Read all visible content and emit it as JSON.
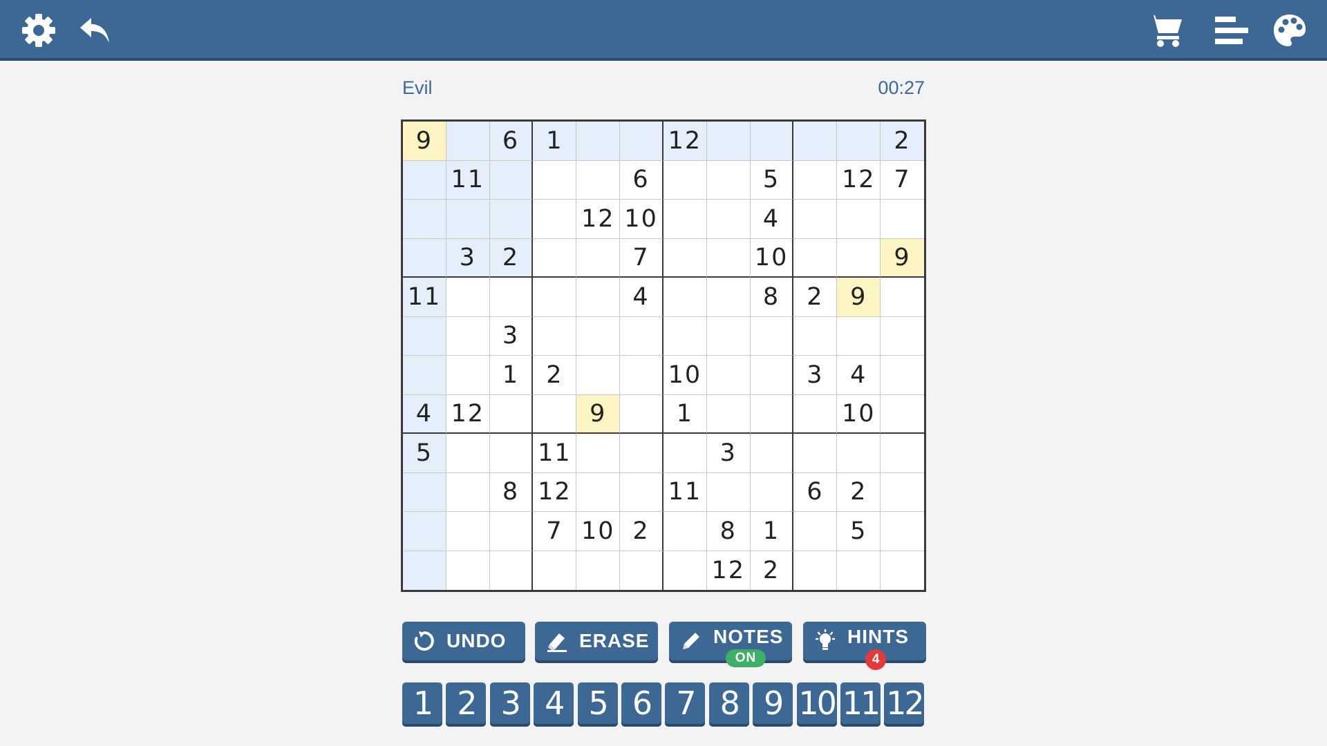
{
  "toolbar": {
    "left_icons": [
      "gear-icon",
      "back-arrow-icon"
    ],
    "right_icons": [
      "cart-icon",
      "menu-icon",
      "palette-icon"
    ]
  },
  "game": {
    "difficulty": "Evil",
    "timer": "00:27"
  },
  "board": {
    "size": 12,
    "box_rows": 4,
    "box_cols": 3,
    "selected_cell": [
      0,
      0
    ],
    "selected_value": "9",
    "cells": [
      [
        "9",
        "",
        "6",
        "1",
        "",
        "",
        "12",
        "",
        "",
        "",
        "",
        "2"
      ],
      [
        "",
        "11",
        "",
        "",
        "",
        "6",
        "",
        "",
        "5",
        "",
        "12",
        "7"
      ],
      [
        "",
        "",
        "",
        "",
        "12",
        "10",
        "",
        "",
        "4",
        "",
        "",
        ""
      ],
      [
        "",
        "3",
        "2",
        "",
        "",
        "7",
        "",
        "",
        "10",
        "",
        "",
        "9"
      ],
      [
        "11",
        "",
        "",
        "",
        "",
        "4",
        "",
        "",
        "8",
        "2",
        "9",
        ""
      ],
      [
        "",
        "",
        "3",
        "",
        "",
        "",
        "",
        "",
        "",
        "",
        "",
        ""
      ],
      [
        "",
        "",
        "1",
        "2",
        "",
        "",
        "10",
        "",
        "",
        "3",
        "4",
        ""
      ],
      [
        "4",
        "12",
        "",
        "",
        "9",
        "",
        "1",
        "",
        "",
        "",
        "10",
        ""
      ],
      [
        "5",
        "",
        "",
        "11",
        "",
        "",
        "",
        "3",
        "",
        "",
        "",
        ""
      ],
      [
        "",
        "",
        "8",
        "12",
        "",
        "",
        "11",
        "",
        "",
        "6",
        "2",
        ""
      ],
      [
        "",
        "",
        "",
        "7",
        "10",
        "2",
        "",
        "8",
        "1",
        "",
        "5",
        ""
      ],
      [
        "",
        "",
        "",
        "",
        "",
        "",
        "",
        "12",
        "2",
        "",
        "",
        ""
      ]
    ]
  },
  "tools": [
    {
      "label": "UNDO",
      "icon": "undo-icon"
    },
    {
      "label": "ERASE",
      "icon": "eraser-icon"
    },
    {
      "label": "NOTES",
      "icon": "pencil-icon",
      "badge": "ON"
    },
    {
      "label": "HINTS",
      "icon": "lightbulb-icon",
      "badge": "4"
    }
  ],
  "numpad": [
    "1",
    "2",
    "3",
    "4",
    "5",
    "6",
    "7",
    "8",
    "9",
    "10",
    "11",
    "12"
  ],
  "colors": {
    "primary": "#3d6894",
    "highlight": "#e4effb",
    "same_value": "#fcf4c2",
    "notes_on": "#3fae68",
    "hint_badge": "#e23a3a"
  }
}
